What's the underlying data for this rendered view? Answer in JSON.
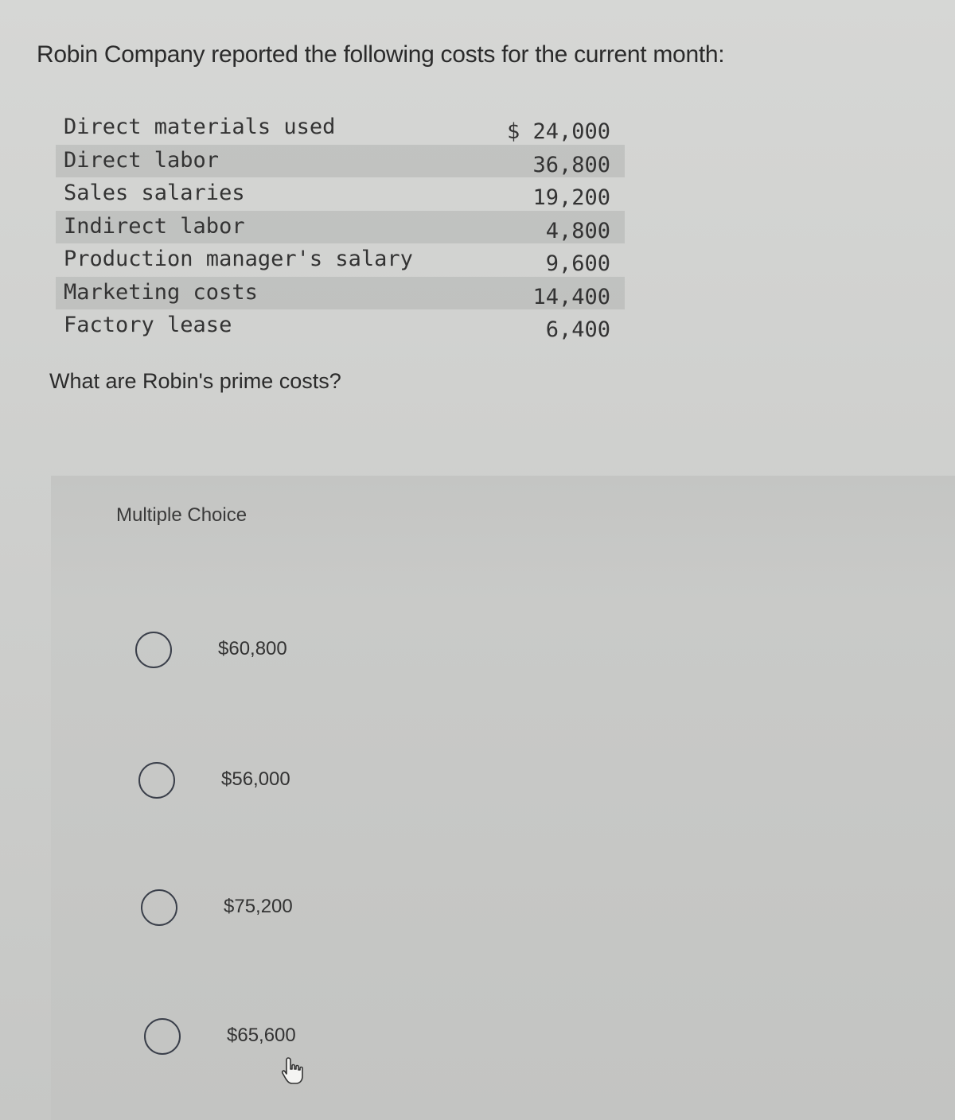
{
  "problem": {
    "intro": "Robin Company reported the following costs for the current month:",
    "costs": [
      {
        "label": "Direct materials used",
        "value": "$ 24,000"
      },
      {
        "label": "Direct labor",
        "value": "36,800"
      },
      {
        "label": "Sales salaries",
        "value": "19,200"
      },
      {
        "label": "Indirect labor",
        "value": "4,800"
      },
      {
        "label": "Production manager's salary",
        "value": "9,600"
      },
      {
        "label": "Marketing costs",
        "value": "14,400"
      },
      {
        "label": "Factory lease",
        "value": "6,400"
      }
    ],
    "question": "What are Robin's prime costs?"
  },
  "multiple_choice": {
    "title": "Multiple Choice",
    "options": [
      {
        "label": "$60,800",
        "selected": false
      },
      {
        "label": "$56,000",
        "selected": false
      },
      {
        "label": "$75,200",
        "selected": false
      },
      {
        "label": "$65,600",
        "selected": false
      }
    ]
  },
  "cursor": {
    "icon": "hand-pointer-icon"
  }
}
